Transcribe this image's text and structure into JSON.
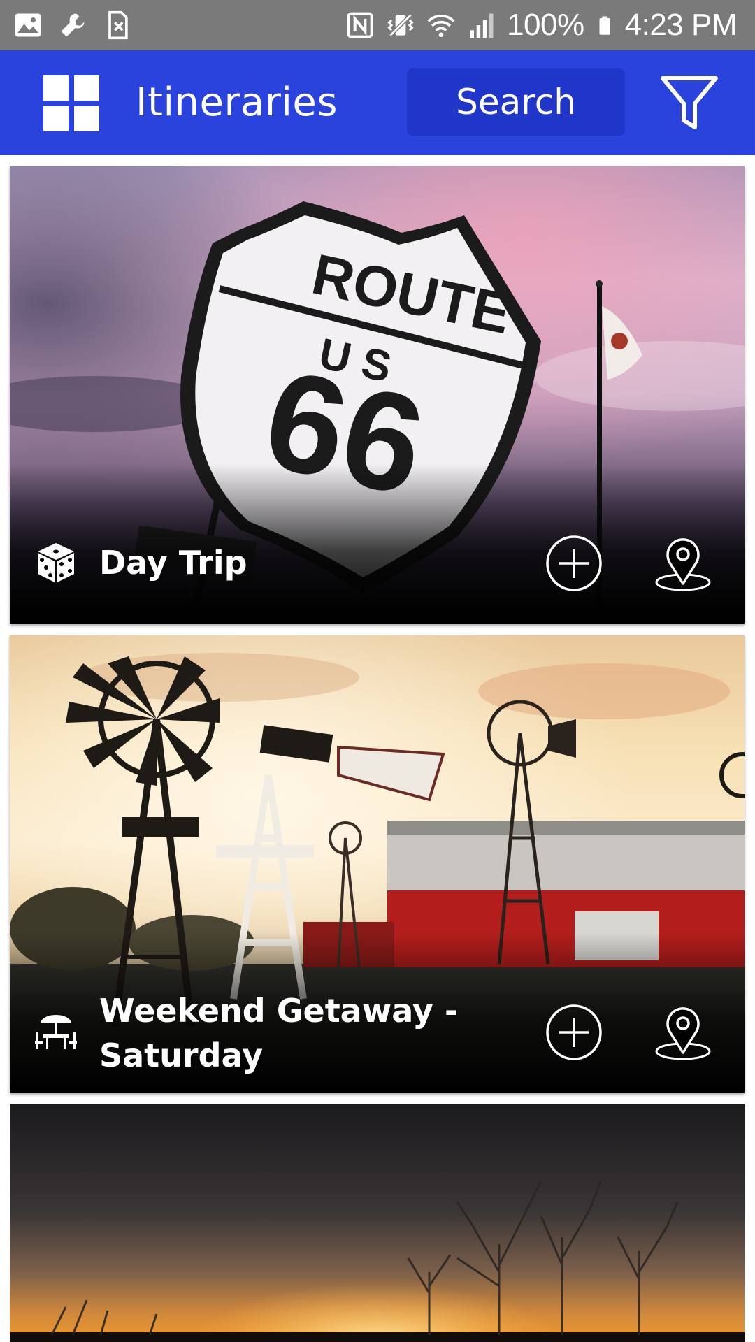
{
  "status_bar": {
    "battery": "100%",
    "time": "4:23 PM",
    "icons": [
      "image-icon",
      "wrench-icon",
      "no-sim-icon",
      "nfc-icon",
      "vibrate-icon",
      "wifi-icon",
      "signal-icon",
      "battery-icon"
    ]
  },
  "app_bar": {
    "title": "Itineraries",
    "search_label": "Search",
    "color": "#2b43dd",
    "search_bg": "#2036c9"
  },
  "cards": [
    {
      "title": "Day Trip",
      "category_icon": "dice-icon"
    },
    {
      "title": "Weekend Getaway - Saturday",
      "category_icon": "picnic-table-icon"
    },
    {
      "title": "",
      "category_icon": ""
    }
  ]
}
